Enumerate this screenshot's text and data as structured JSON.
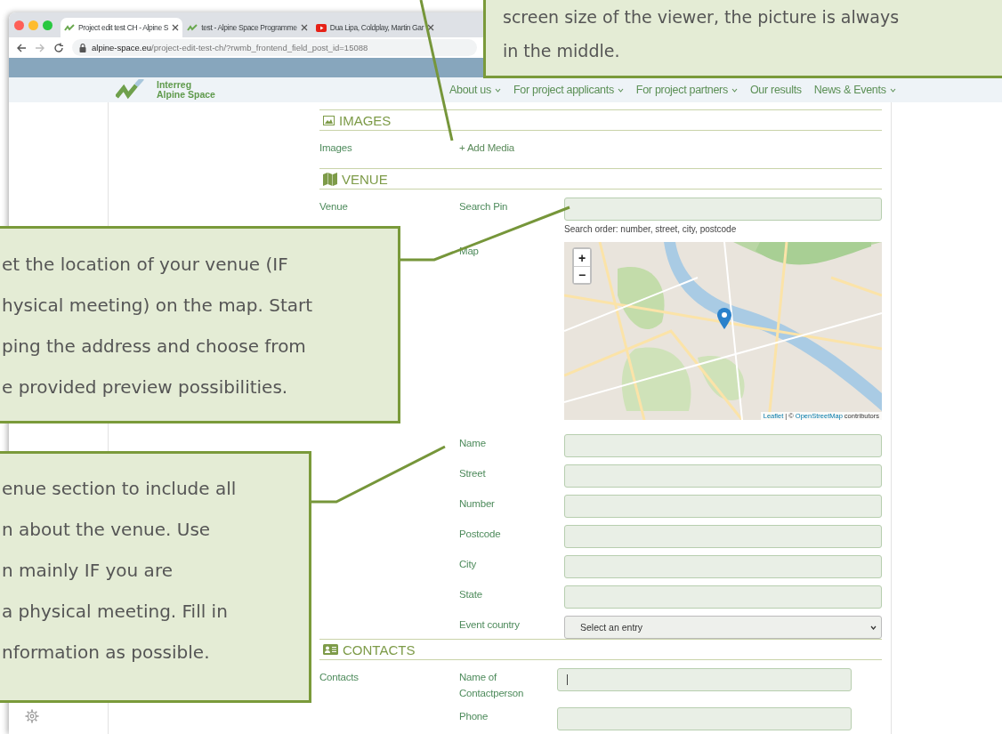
{
  "browser": {
    "tabs": [
      {
        "title": "Project edit test CH - Alpine S",
        "kind": "site",
        "selected": true
      },
      {
        "title": "test - Alpine Space Programme",
        "kind": "site",
        "selected": false
      },
      {
        "title": "Dua Lipa, Coldplay, Martin Gar",
        "kind": "video",
        "selected": false
      }
    ],
    "address": {
      "host": "alpine-space.eu",
      "path": "/project-edit-test-ch/?rwmb_frontend_field_post_id=15088"
    }
  },
  "site": {
    "logo_lines": [
      "Interreg",
      "Alpine Space"
    ],
    "nav": [
      {
        "label": "About us",
        "has_menu": true
      },
      {
        "label": "For project applicants",
        "has_menu": true
      },
      {
        "label": "For project partners",
        "has_menu": true
      },
      {
        "label": "Our results",
        "has_menu": false
      },
      {
        "label": "News & Events",
        "has_menu": true
      }
    ]
  },
  "form": {
    "sections": [
      {
        "kind": "images",
        "title": "IMAGES",
        "group": "Images",
        "fields": [
          {
            "kind": "link",
            "label": "+ Add Media"
          }
        ]
      },
      {
        "kind": "venue",
        "title": "VENUE",
        "group": "Venue",
        "fields": [
          {
            "kind": "input",
            "label": "Search Pin",
            "hint": "Search order: number, street, city, postcode"
          },
          {
            "kind": "map",
            "label": "Map",
            "zoom_in": "+",
            "zoom_out": "−",
            "attribution": {
              "leaflet": "Leaflet",
              "separator": "| ©",
              "osm": "OpenStreetMap",
              "suffix": "contributors"
            }
          },
          {
            "kind": "input",
            "label": "Name"
          },
          {
            "kind": "input",
            "label": "Street"
          },
          {
            "kind": "input",
            "label": "Number"
          },
          {
            "kind": "input",
            "label": "Postcode"
          },
          {
            "kind": "input",
            "label": "City"
          },
          {
            "kind": "input",
            "label": "State"
          },
          {
            "kind": "select",
            "label": "Event country",
            "value": "Select an entry"
          }
        ]
      },
      {
        "kind": "contacts",
        "title": "CONTACTS",
        "group": "Contacts",
        "fields": [
          {
            "kind": "input",
            "label": "Name of Contactperson",
            "focused": true
          },
          {
            "kind": "input",
            "label": "Phone"
          }
        ]
      }
    ]
  },
  "callouts": [
    {
      "lines": [
        "screen size of the viewer, the picture is always",
        "in the middle."
      ]
    },
    {
      "lines": [
        "et the location of your venue (IF",
        "hysical meeting) on the map. Start",
        "ping the address and choose from",
        "e provided preview possibilities."
      ]
    },
    {
      "lines": [
        "enue section to include all",
        "n about the venue. Use",
        "n mainly IF you are",
        "a physical meeting. Fill in",
        "nformation as possible."
      ]
    }
  ]
}
